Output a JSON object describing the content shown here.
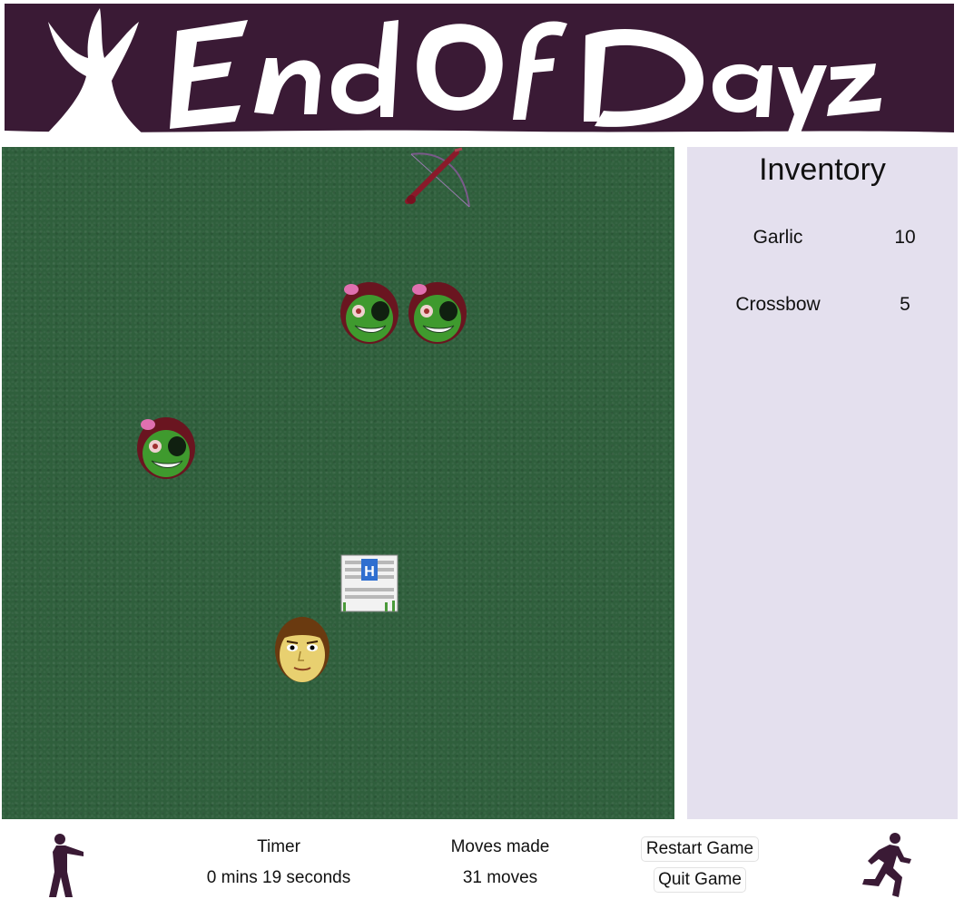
{
  "banner": {
    "title": "End Of Dayz",
    "background": "#3a1a35",
    "logo_color": "#ffffff"
  },
  "board": {
    "background": "#2f5f3c",
    "sprites": [
      {
        "name": "crossbow-item",
        "icon": "crossbow-icon"
      },
      {
        "name": "zombie-1",
        "icon": "zombie-icon"
      },
      {
        "name": "zombie-2",
        "icon": "zombie-icon"
      },
      {
        "name": "zombie-3",
        "icon": "zombie-icon"
      },
      {
        "name": "hospital",
        "icon": "hospital-icon",
        "sign": "H"
      },
      {
        "name": "player",
        "icon": "player-icon"
      }
    ]
  },
  "inventory": {
    "title": "Inventory",
    "background": "#e4e0ee",
    "items": [
      {
        "name": "Garlic",
        "count": "10"
      },
      {
        "name": "Crossbow",
        "count": "5"
      }
    ]
  },
  "footer": {
    "timer_label": "Timer",
    "timer_value": "0 mins 19 seconds",
    "moves_label": "Moves made",
    "moves_value": "31 moves",
    "restart_label": "Restart Game",
    "quit_label": "Quit Game",
    "left_icon": "zombie-silhouette-icon",
    "right_icon": "running-man-icon",
    "silhouette_color": "#3a1a35"
  }
}
